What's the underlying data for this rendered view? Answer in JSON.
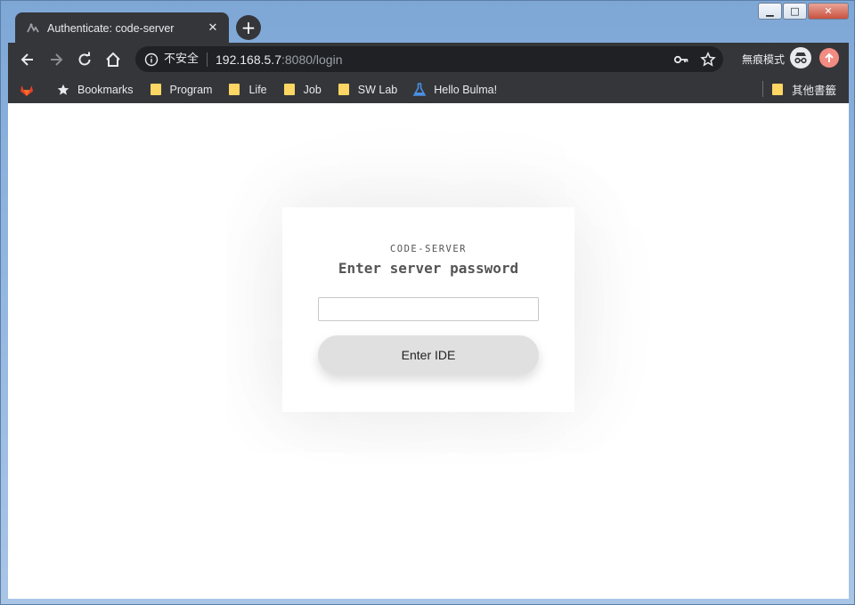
{
  "tab": {
    "title": "Authenticate: code-server",
    "close_icon": "close-icon"
  },
  "new_tab_label": "+",
  "window_controls": {
    "min": "▁",
    "max": "□",
    "close": "✕"
  },
  "toolbar": {
    "security_label": "不安全",
    "url_host": "192.168.5.7",
    "url_rest": ":8080/login",
    "incognito_label": "無痕模式"
  },
  "bookmarks": {
    "items": [
      {
        "label": "",
        "icon": "gitlab-icon"
      },
      {
        "label": "Bookmarks",
        "icon": "star-icon"
      },
      {
        "label": "Program",
        "icon": "folder-icon"
      },
      {
        "label": "Life",
        "icon": "folder-icon"
      },
      {
        "label": "Job",
        "icon": "folder-icon"
      },
      {
        "label": "SW Lab",
        "icon": "folder-icon"
      },
      {
        "label": "Hello Bulma!",
        "icon": "flask-icon"
      }
    ],
    "other_label": "其他書籤"
  },
  "login": {
    "subtitle": "CODE-SERVER",
    "title": "Enter server password",
    "password_value": "",
    "submit_label": "Enter IDE"
  },
  "colors": {
    "chrome_dark": "#35363a",
    "omnibox": "#202124",
    "folder": "#fdd663",
    "button": "#e0e0e0"
  }
}
